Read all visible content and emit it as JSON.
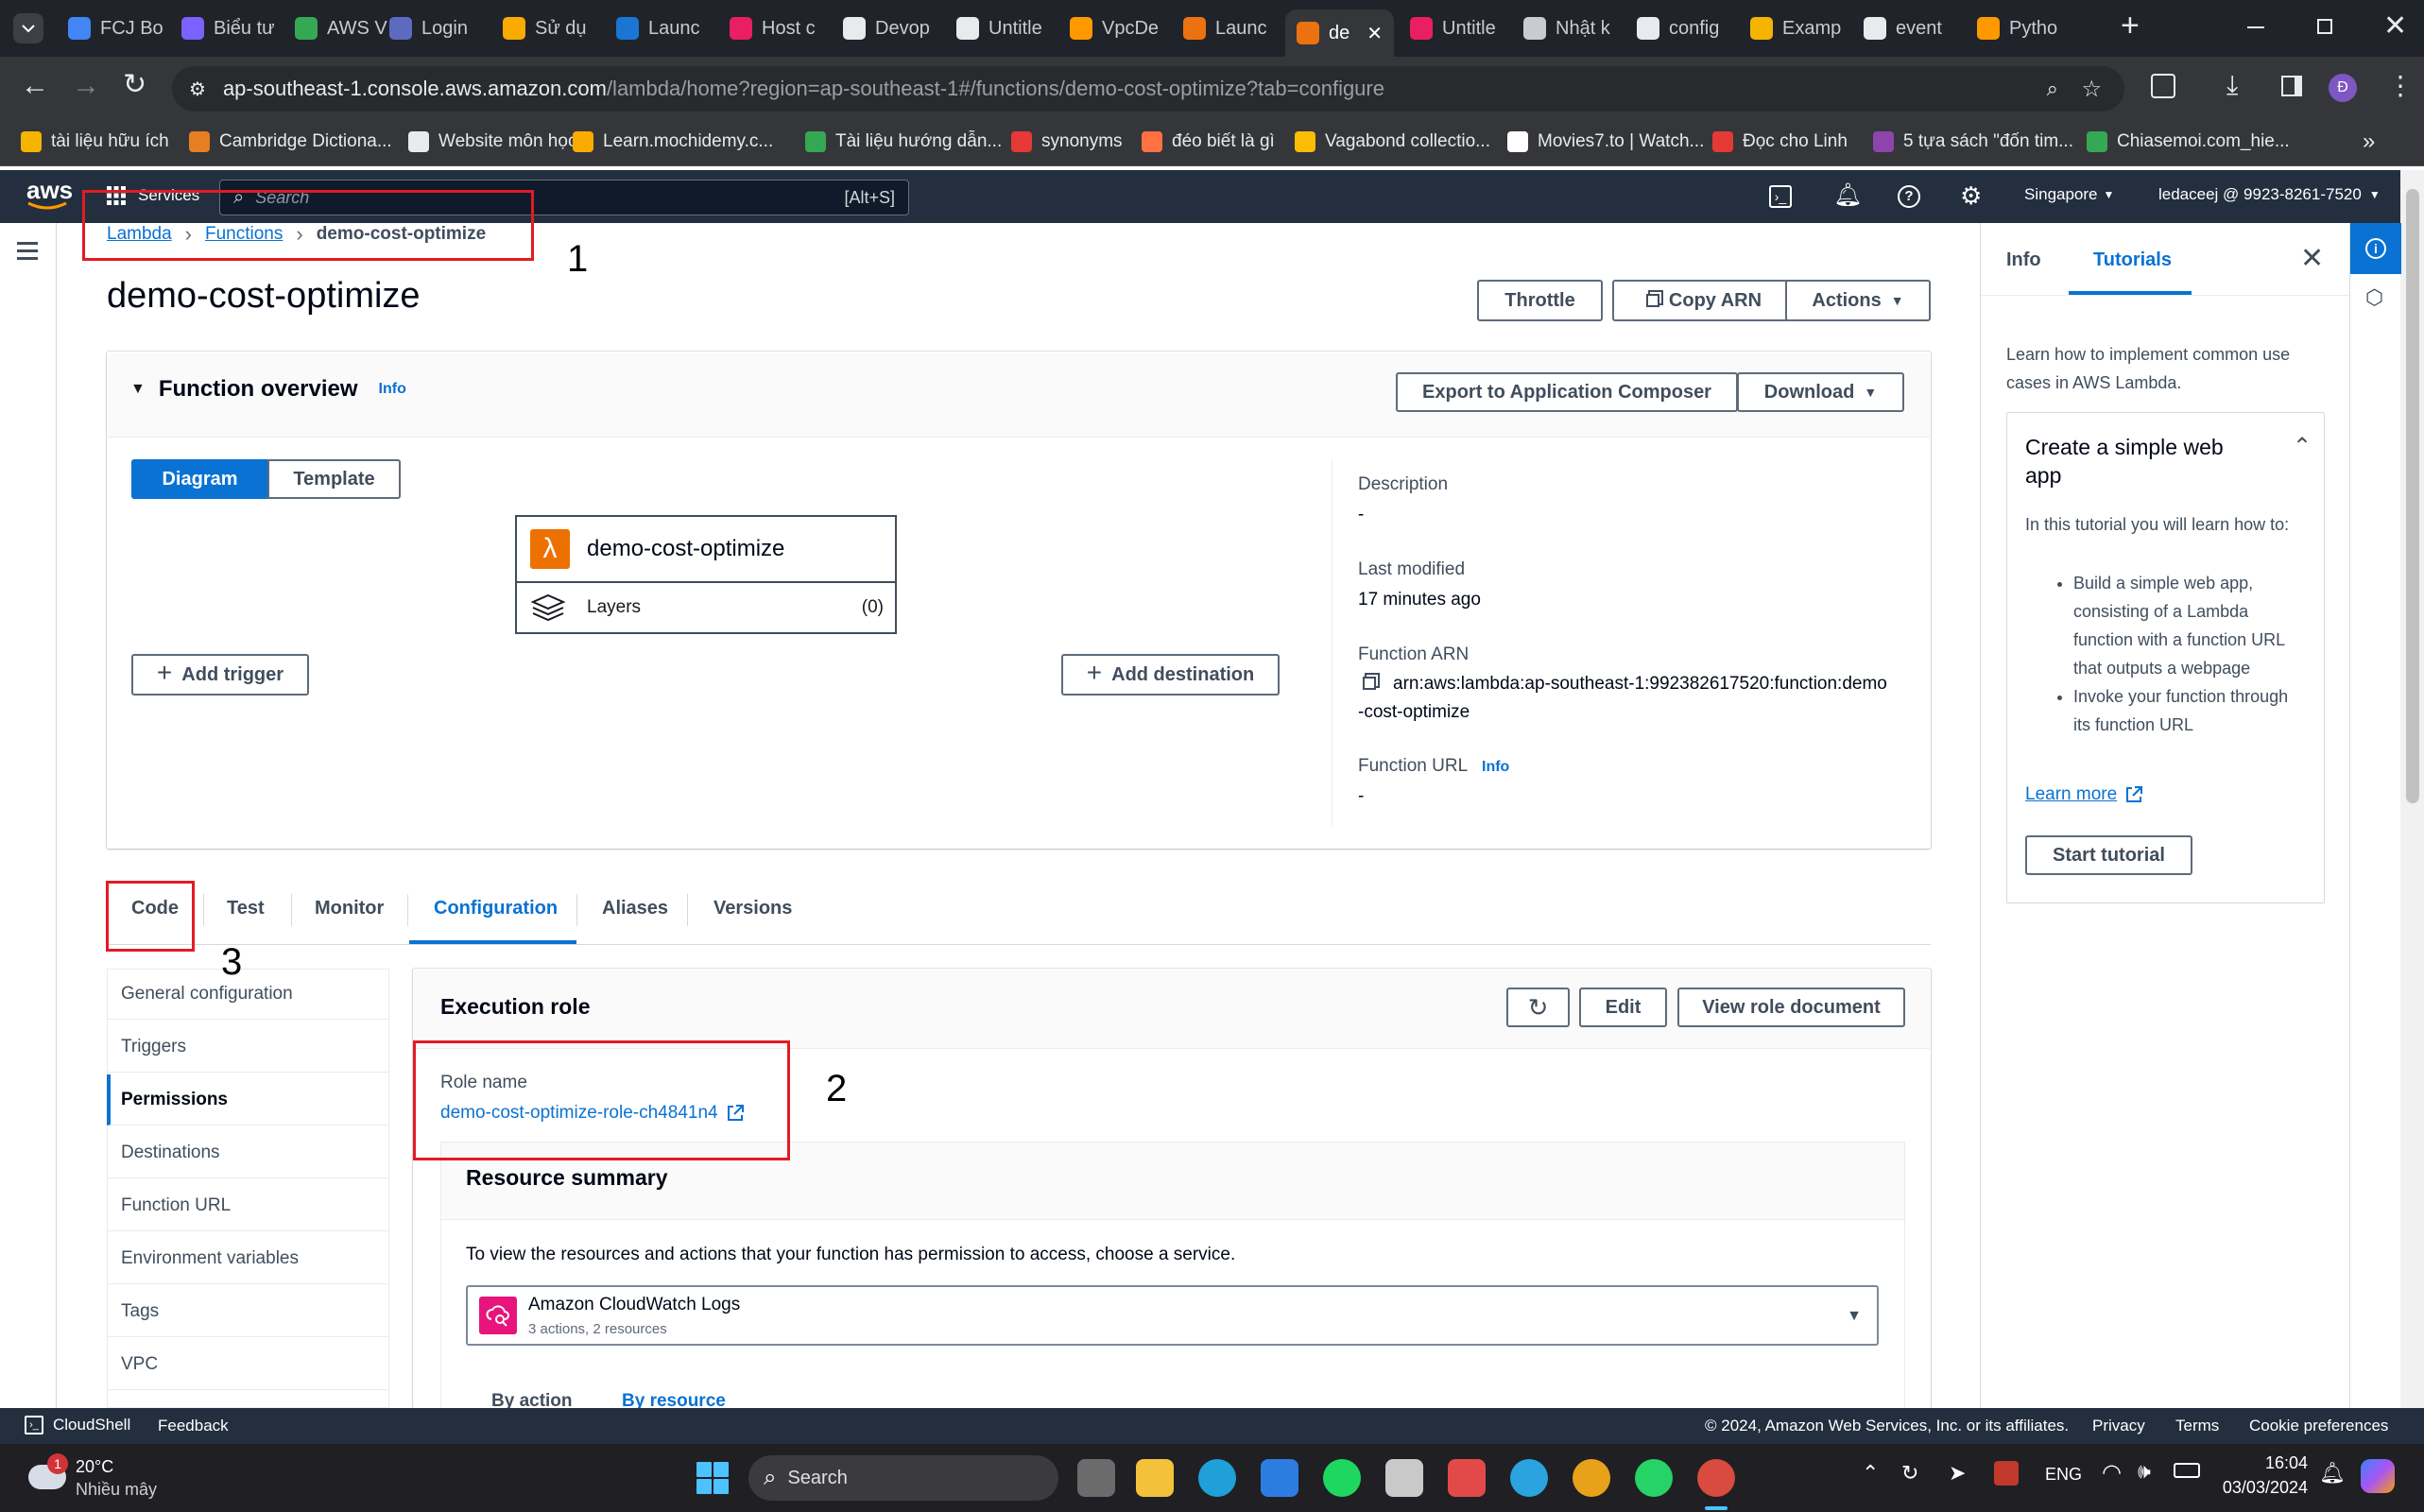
{
  "browser": {
    "tabs": [
      {
        "label": "FCJ Bo",
        "color": "#4285f4"
      },
      {
        "label": "Biểu tư",
        "color": "#7b61ff"
      },
      {
        "label": "AWS V",
        "color": "#34a853"
      },
      {
        "label": "Login",
        "color": "#5c6bc0"
      },
      {
        "label": "Sử dụ",
        "color": "#f9ab00"
      },
      {
        "label": "Launc",
        "color": "#1976d2"
      },
      {
        "label": "Host c",
        "color": "#e91e63"
      },
      {
        "label": "Devop",
        "color": "#e8eaed"
      },
      {
        "label": "Untitle",
        "color": "#e8eaed"
      },
      {
        "label": "VpcDe",
        "color": "#ff9900"
      },
      {
        "label": "Launc",
        "color": "#ec7211"
      },
      {
        "label": "de",
        "color": "#ec7211"
      },
      {
        "label": "Untitle",
        "color": "#e91e63"
      },
      {
        "label": "Nhật k",
        "color": "#c8cbd0"
      },
      {
        "label": "config",
        "color": "#e8eaed"
      },
      {
        "label": "Examp",
        "color": "#f4b400"
      },
      {
        "label": "event",
        "color": "#e8eaed"
      },
      {
        "label": "Pytho",
        "color": "#ff9900"
      }
    ],
    "url_host": "ap-southeast-1.console.aws.amazon.com",
    "url_path": "/lambda/home?region=ap-southeast-1#/functions/demo-cost-optimize?tab=configure",
    "bookmarks": [
      "tài liệu hữu ích",
      "Cambridge Dictiona...",
      "Website môn học",
      "Learn.mochidemy.c...",
      "Tài liệu hướng dẫn...",
      "synonyms",
      "đéo biết là gì",
      "Vagabond collectio...",
      "Movies7.to | Watch...",
      "Đọc cho Linh",
      "5 tựa sách \"đốn tim...",
      "Chiasemoi.com_hie..."
    ],
    "profile_initial": "Đ"
  },
  "aws_nav": {
    "logo": "aws",
    "services": "Services",
    "search_placeholder": "Search",
    "search_shortcut": "[Alt+S]",
    "region": "Singapore",
    "account": "ledaceej @ 9923-8261-7520"
  },
  "breadcrumb": {
    "root": "Lambda",
    "mid": "Functions",
    "current": "demo-cost-optimize"
  },
  "page": {
    "title": "demo-cost-optimize",
    "throttle": "Throttle",
    "copy_arn": "Copy ARN",
    "actions": "Actions"
  },
  "overview": {
    "heading": "Function overview",
    "info": "Info",
    "export": "Export to Application Composer",
    "download": "Download",
    "view_diagram": "Diagram",
    "view_template": "Template",
    "function_name": "demo-cost-optimize",
    "layers": "Layers",
    "layers_count": "(0)",
    "add_trigger": "Add trigger",
    "add_destination": "Add destination",
    "description_label": "Description",
    "description_value": "-",
    "modified_label": "Last modified",
    "modified_value": "17 minutes ago",
    "arn_label": "Function ARN",
    "arn_line1": "arn:aws:lambda:ap-southeast-1:992382617520:function:demo",
    "arn_line2": "-cost-optimize",
    "url_label": "Function URL",
    "url_info": "Info",
    "url_value": "-"
  },
  "tabs": [
    "Code",
    "Test",
    "Monitor",
    "Configuration",
    "Aliases",
    "Versions"
  ],
  "config_nav": [
    "General configuration",
    "Triggers",
    "Permissions",
    "Destinations",
    "Function URL",
    "Environment variables",
    "Tags",
    "VPC"
  ],
  "execution_role": {
    "heading": "Execution role",
    "edit": "Edit",
    "view_doc": "View role document",
    "role_label": "Role name",
    "role_value": "demo-cost-optimize-role-ch4841n4"
  },
  "resource_summary": {
    "heading": "Resource summary",
    "description": "To view the resources and actions that your function has permission to access, choose a service.",
    "service": "Amazon CloudWatch Logs",
    "service_sub": "3 actions, 2 resources",
    "by_action": "By action",
    "by_resource": "By resource"
  },
  "annotations": [
    "1",
    "2",
    "3"
  ],
  "help_panel": {
    "tab_info": "Info",
    "tab_tutorials": "Tutorials",
    "intro": "Learn how to implement common use cases in AWS Lambda.",
    "card_title": "Create a simple web app",
    "card_desc": "In this tutorial you will learn how to:",
    "bullet1": "Build a simple web app, consisting of a Lambda function with a function URL that outputs a webpage",
    "bullet2": "Invoke your function through its function URL",
    "learn_more": "Learn more",
    "start": "Start tutorial"
  },
  "footer": {
    "cloudshell": "CloudShell",
    "feedback": "Feedback",
    "copyright": "© 2024, Amazon Web Services, Inc. or its affiliates.",
    "privacy": "Privacy",
    "terms": "Terms",
    "cookies": "Cookie preferences"
  },
  "taskbar": {
    "weather_temp": "20°C",
    "weather_desc": "Nhiều mây",
    "weather_badge": "1",
    "search": "Search",
    "lang": "ENG",
    "time": "16:04",
    "date": "03/03/2024"
  }
}
